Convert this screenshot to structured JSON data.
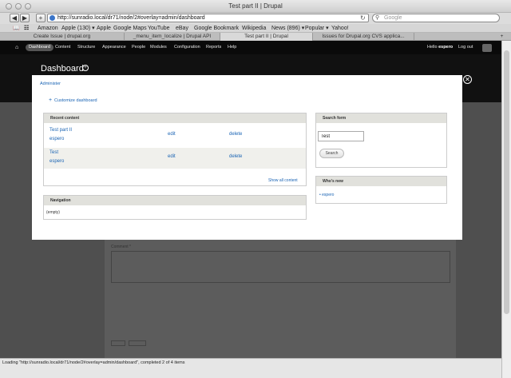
{
  "window": {
    "title": "Test part II | Drupal"
  },
  "browser": {
    "url": "http://sunradio.local/dr71/node/2#overlay=admin/dashboard",
    "search_placeholder": "Google",
    "bookmarks": [
      "Amazon",
      "Apple (130) ▾",
      "Apple",
      "Google Maps",
      "YouTube",
      "eBay",
      "Google Bookmark",
      "Wikipedia",
      "News (896) ▾",
      "Popular ▾",
      "Yahoo!"
    ],
    "tabs": [
      "Create Issue | drupal.org",
      "_menu_item_localize | Drupal API",
      "Test part II | Drupal",
      "Issues for Drupal.org CVS applica..."
    ],
    "status": "Loading \"http://sunradio.local/dr71/node/2#overlay=admin/dashboard\", completed 2 of 4 items"
  },
  "toolbar": {
    "items": [
      "Dashboard",
      "Content",
      "Structure",
      "Appearance",
      "People",
      "Modules",
      "Configuration",
      "Reports",
      "Help"
    ],
    "hello_prefix": "Hello",
    "user": "espero",
    "logout": "Log out"
  },
  "page": {
    "title": "Dashboard",
    "bg_comment": "Comment *"
  },
  "overlay": {
    "breadcrumb": "Administer",
    "customize": "Customize dashboard",
    "recent_content": {
      "title": "Recent content",
      "rows": [
        {
          "title": "Test part II",
          "author": "espero",
          "edit": "edit",
          "delete": "delete"
        },
        {
          "title": "Test",
          "author": "espero",
          "edit": "edit",
          "delete": "delete"
        }
      ],
      "show_all": "Show all content"
    },
    "navigation": {
      "title": "Navigation",
      "empty": "(empty)"
    },
    "search_form": {
      "title": "Search form",
      "value": "Test",
      "button": "Search"
    },
    "whos_new": {
      "title": "Who's new",
      "items": [
        "espero"
      ]
    }
  }
}
